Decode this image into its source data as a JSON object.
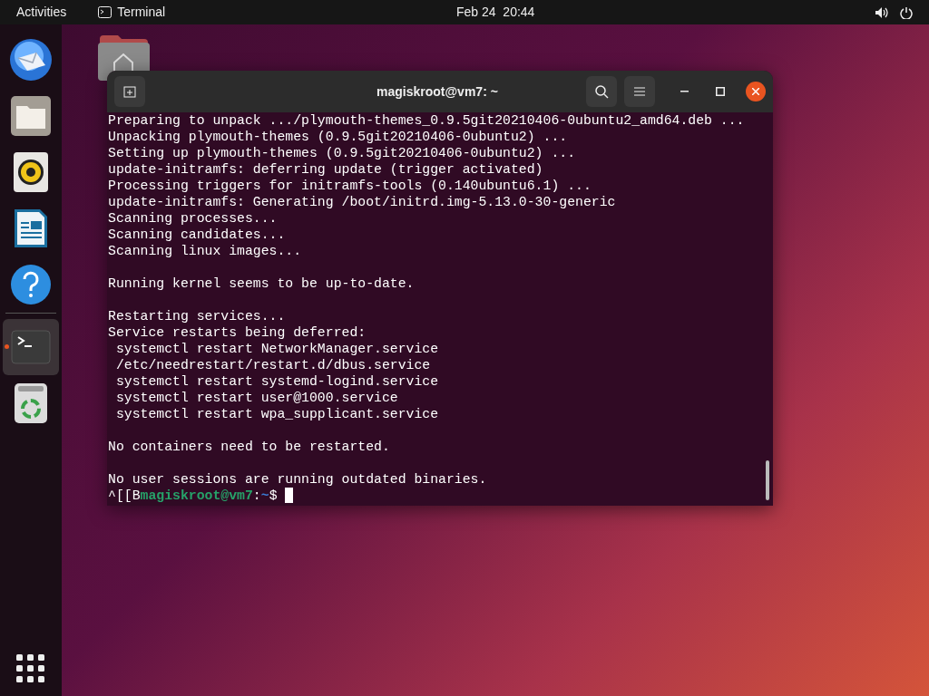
{
  "top_bar": {
    "activities": "Activities",
    "app_name": "Terminal",
    "clock": "Feb 24  20:44"
  },
  "dock": {
    "items": [
      {
        "kind": "mail",
        "selected": false,
        "running": false
      },
      {
        "kind": "files",
        "selected": false,
        "running": false
      },
      {
        "kind": "music",
        "selected": false,
        "running": false
      },
      {
        "kind": "writer",
        "selected": false,
        "running": false
      },
      {
        "kind": "help",
        "selected": false,
        "running": false
      },
      {
        "kind": "terminal",
        "selected": true,
        "running": true
      },
      {
        "kind": "trash",
        "selected": false,
        "running": false
      }
    ]
  },
  "terminal": {
    "title": "magiskroot@vm7: ~",
    "lines": [
      {
        "text": "Preparing to unpack .../plymouth-themes_0.9.5git20210406-0ubuntu2_amd64.deb ..."
      },
      {
        "text": "Unpacking plymouth-themes (0.9.5git20210406-0ubuntu2) ..."
      },
      {
        "text": "Setting up plymouth-themes (0.9.5git20210406-0ubuntu2) ..."
      },
      {
        "text": "update-initramfs: deferring update (trigger activated)"
      },
      {
        "text": "Processing triggers for initramfs-tools (0.140ubuntu6.1) ..."
      },
      {
        "text": "update-initramfs: Generating /boot/initrd.img-5.13.0-30-generic"
      },
      {
        "text": "Scanning processes..."
      },
      {
        "text": "Scanning candidates..."
      },
      {
        "text": "Scanning linux images..."
      },
      {
        "kind": "blank"
      },
      {
        "text": "Running kernel seems to be up-to-date."
      },
      {
        "kind": "blank"
      },
      {
        "text": "Restarting services..."
      },
      {
        "text": "Service restarts being deferred:"
      },
      {
        "text": " systemctl restart NetworkManager.service"
      },
      {
        "text": " /etc/needrestart/restart.d/dbus.service"
      },
      {
        "text": " systemctl restart systemd-logind.service"
      },
      {
        "text": " systemctl restart user@1000.service"
      },
      {
        "text": " systemctl restart wpa_supplicant.service"
      },
      {
        "kind": "blank"
      },
      {
        "text": "No containers need to be restarted."
      },
      {
        "kind": "blank"
      },
      {
        "text": "No user sessions are running outdated binaries."
      }
    ],
    "prompt": {
      "prefix": "^[[B",
      "user_host": "magiskroot@vm7",
      "separator": ":",
      "path": "~",
      "symbol": "$"
    }
  }
}
